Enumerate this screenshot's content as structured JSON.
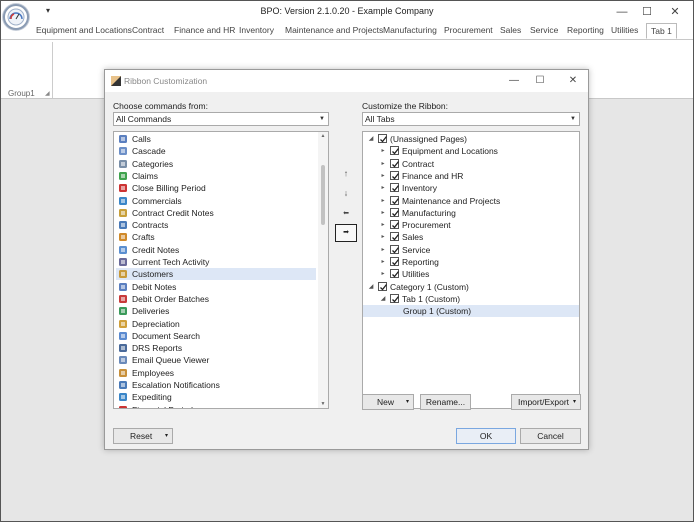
{
  "app": {
    "title": "BPO: Version 2.1.0.20 - Example Company",
    "qat_arrow": "▾",
    "win_minimize": "—",
    "win_maximize": "☐",
    "win_close": "✕"
  },
  "ribbon": {
    "tabs": [
      "Equipment and Locations",
      "Contract",
      "Finance and HR",
      "Inventory",
      "Maintenance and Projects",
      "Manufacturing",
      "Procurement",
      "Sales",
      "Service",
      "Reporting",
      "Utilities",
      "Tab 1"
    ],
    "active_tab": "Tab 1",
    "group_label": "Group1"
  },
  "dialog": {
    "title": "Ribbon Customization",
    "win_minimize": "—",
    "win_maximize": "☐",
    "win_close": "✕",
    "left_label": "Choose commands from:",
    "left_combo": "All Commands",
    "right_label": "Customize the Ribbon:",
    "right_combo": "All Tabs",
    "commands": [
      {
        "label": "Calls",
        "icon": "phone-icon"
      },
      {
        "label": "Cascade",
        "icon": "cascade-icon"
      },
      {
        "label": "Categories",
        "icon": "categories-icon"
      },
      {
        "label": "Claims",
        "icon": "claims-icon"
      },
      {
        "label": "Close Billing Period",
        "icon": "close-billing-icon"
      },
      {
        "label": "Commercials",
        "icon": "commercials-icon"
      },
      {
        "label": "Contract Credit Notes",
        "icon": "credit-notes-icon"
      },
      {
        "label": "Contracts",
        "icon": "contracts-icon"
      },
      {
        "label": "Crafts",
        "icon": "crafts-icon"
      },
      {
        "label": "Credit Notes",
        "icon": "credit-notes-icon"
      },
      {
        "label": "Current Tech Activity",
        "icon": "tech-activity-icon"
      },
      {
        "label": "Customers",
        "icon": "customers-icon"
      },
      {
        "label": "Debit Notes",
        "icon": "debit-notes-icon"
      },
      {
        "label": "Debit Order Batches",
        "icon": "debit-order-icon"
      },
      {
        "label": "Deliveries",
        "icon": "deliveries-icon"
      },
      {
        "label": "Depreciation",
        "icon": "depreciation-icon"
      },
      {
        "label": "Document Search",
        "icon": "document-search-icon"
      },
      {
        "label": "DRS Reports",
        "icon": "drs-reports-icon"
      },
      {
        "label": "Email Queue Viewer",
        "icon": "email-icon"
      },
      {
        "label": "Employees",
        "icon": "employees-icon"
      },
      {
        "label": "Escalation Notifications",
        "icon": "escalation-icon"
      },
      {
        "label": "Expediting",
        "icon": "expediting-icon"
      },
      {
        "label": "Financial Periods",
        "icon": "financial-periods-icon"
      }
    ],
    "selected_command": "Customers",
    "move_buttons": {
      "up": "🠕",
      "down": "🠗",
      "remove": "⬅",
      "add": "➡"
    },
    "tree": [
      {
        "label": "(Unassigned Pages)",
        "level": 0,
        "expander": "◢"
      },
      {
        "label": "Equipment and Locations",
        "level": 1,
        "expander": "▸"
      },
      {
        "label": "Contract",
        "level": 1,
        "expander": "▸"
      },
      {
        "label": "Finance and HR",
        "level": 1,
        "expander": "▸"
      },
      {
        "label": "Inventory",
        "level": 1,
        "expander": "▸"
      },
      {
        "label": "Maintenance and Projects",
        "level": 1,
        "expander": "▸"
      },
      {
        "label": "Manufacturing",
        "level": 1,
        "expander": "▸"
      },
      {
        "label": "Procurement",
        "level": 1,
        "expander": "▸"
      },
      {
        "label": "Sales",
        "level": 1,
        "expander": "▸"
      },
      {
        "label": "Service",
        "level": 1,
        "expander": "▸"
      },
      {
        "label": "Reporting",
        "level": 1,
        "expander": "▸"
      },
      {
        "label": "Utilities",
        "level": 1,
        "expander": "▸"
      },
      {
        "label": "Category 1 (Custom)",
        "level": 0,
        "expander": "◢"
      },
      {
        "label": "Tab 1 (Custom)",
        "level": 1,
        "expander": "◢"
      },
      {
        "label": "Group 1 (Custom)",
        "level": 2,
        "expander": ""
      }
    ],
    "selected_tree_item": "Group 1 (Custom)",
    "new_button": "New",
    "rename_button": "Rename...",
    "import_export_button": "Import/Export",
    "reset_button": "Reset",
    "ok_button": "OK",
    "cancel_button": "Cancel",
    "dropdown_arrow": "▾",
    "combo_arrow": "▼"
  },
  "colors": {
    "selection": "#dde7f6",
    "check": "#222222",
    "ok_border": "#7aa7e0"
  }
}
